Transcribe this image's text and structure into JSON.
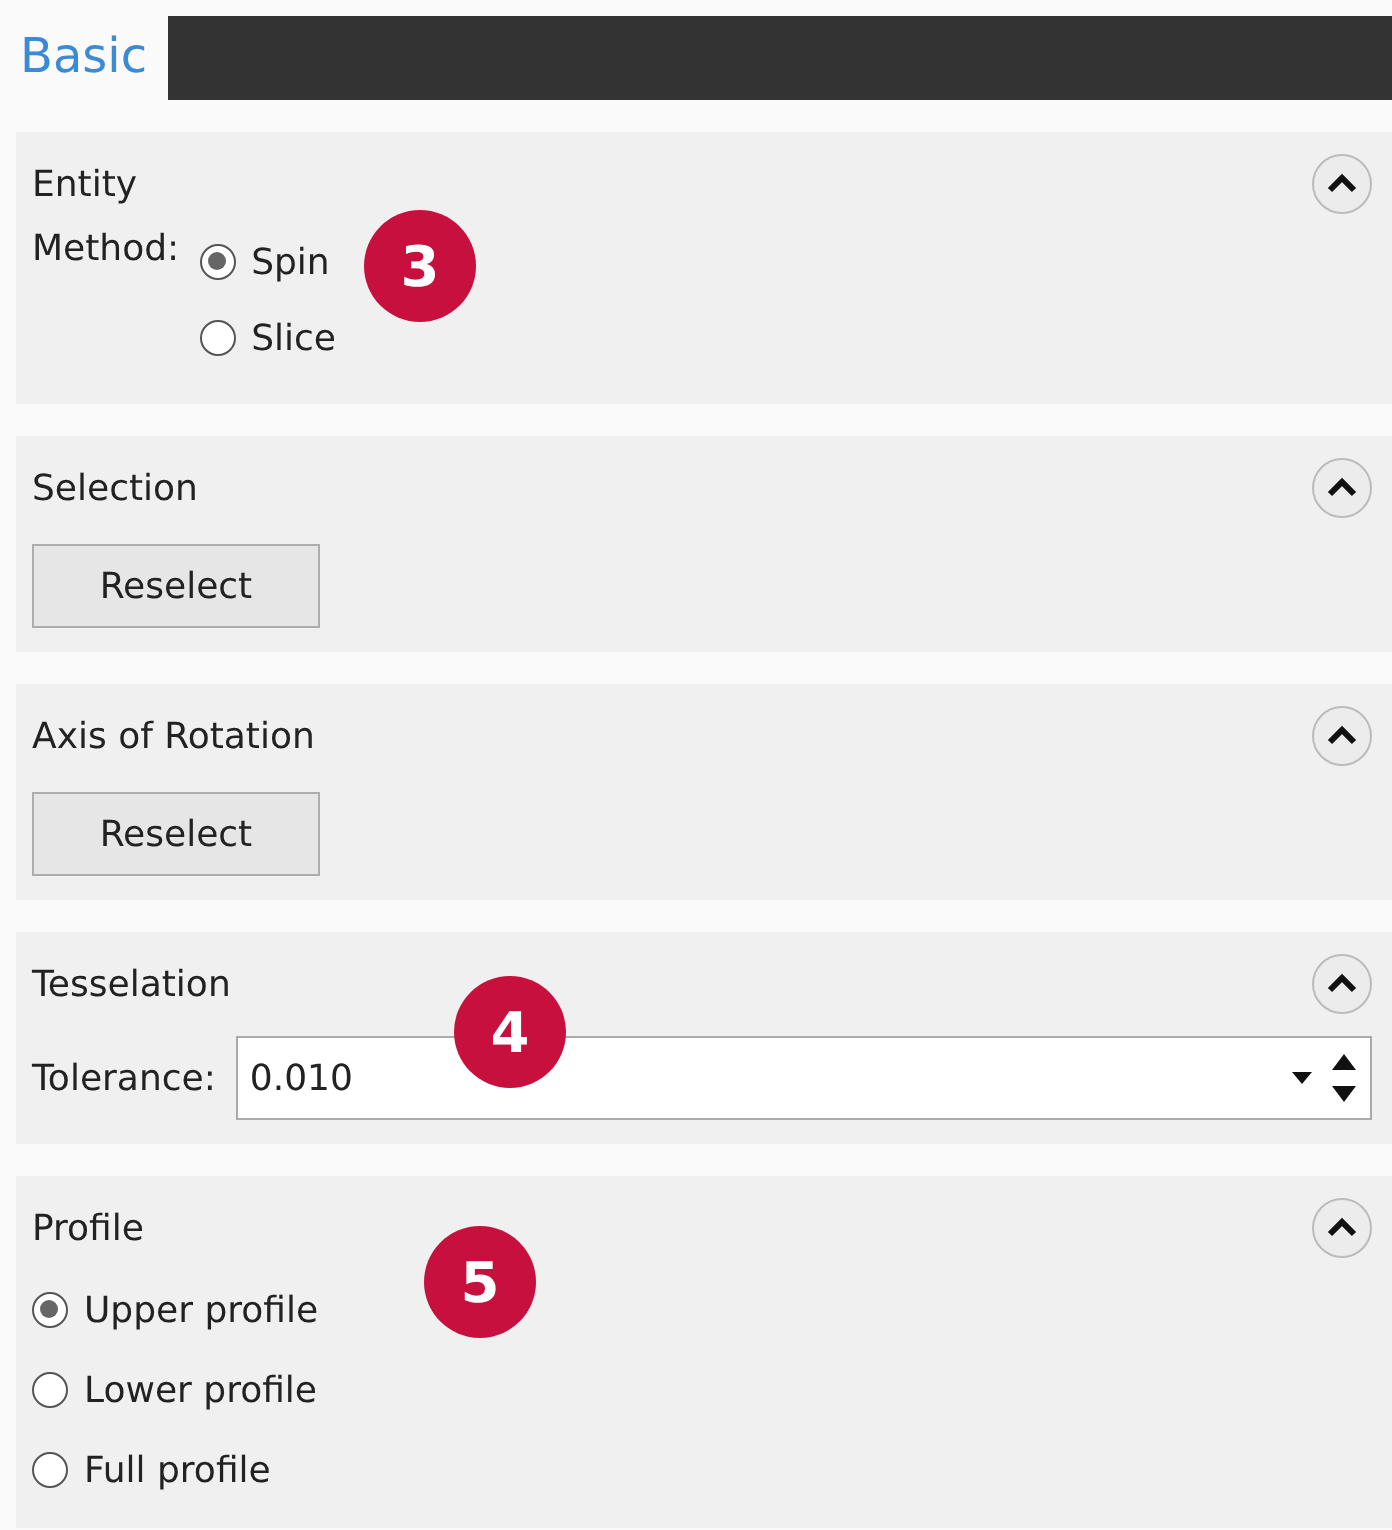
{
  "tab": {
    "label": "Basic",
    "selected": true
  },
  "sections": [
    {
      "kind": "labeled-radios",
      "title": "Entity",
      "expanded": true,
      "badge": "3",
      "label": "Method:",
      "options": [
        {
          "label": "Spin",
          "selected": true
        },
        {
          "label": "Slice",
          "selected": false
        }
      ]
    },
    {
      "kind": "button",
      "title": "Selection",
      "expanded": true,
      "button": "Reselect"
    },
    {
      "kind": "button",
      "title": "Axis of Rotation",
      "expanded": true,
      "button": "Reselect"
    },
    {
      "kind": "field",
      "title": "Tesselation",
      "expanded": true,
      "badge": "4",
      "label": "Tolerance:",
      "value": "0.010"
    },
    {
      "kind": "radios",
      "title": "Profile",
      "expanded": true,
      "badge": "5",
      "options": [
        {
          "label": "Upper profile",
          "selected": true
        },
        {
          "label": "Lower profile",
          "selected": false
        },
        {
          "label": "Full profile",
          "selected": false
        }
      ]
    }
  ]
}
